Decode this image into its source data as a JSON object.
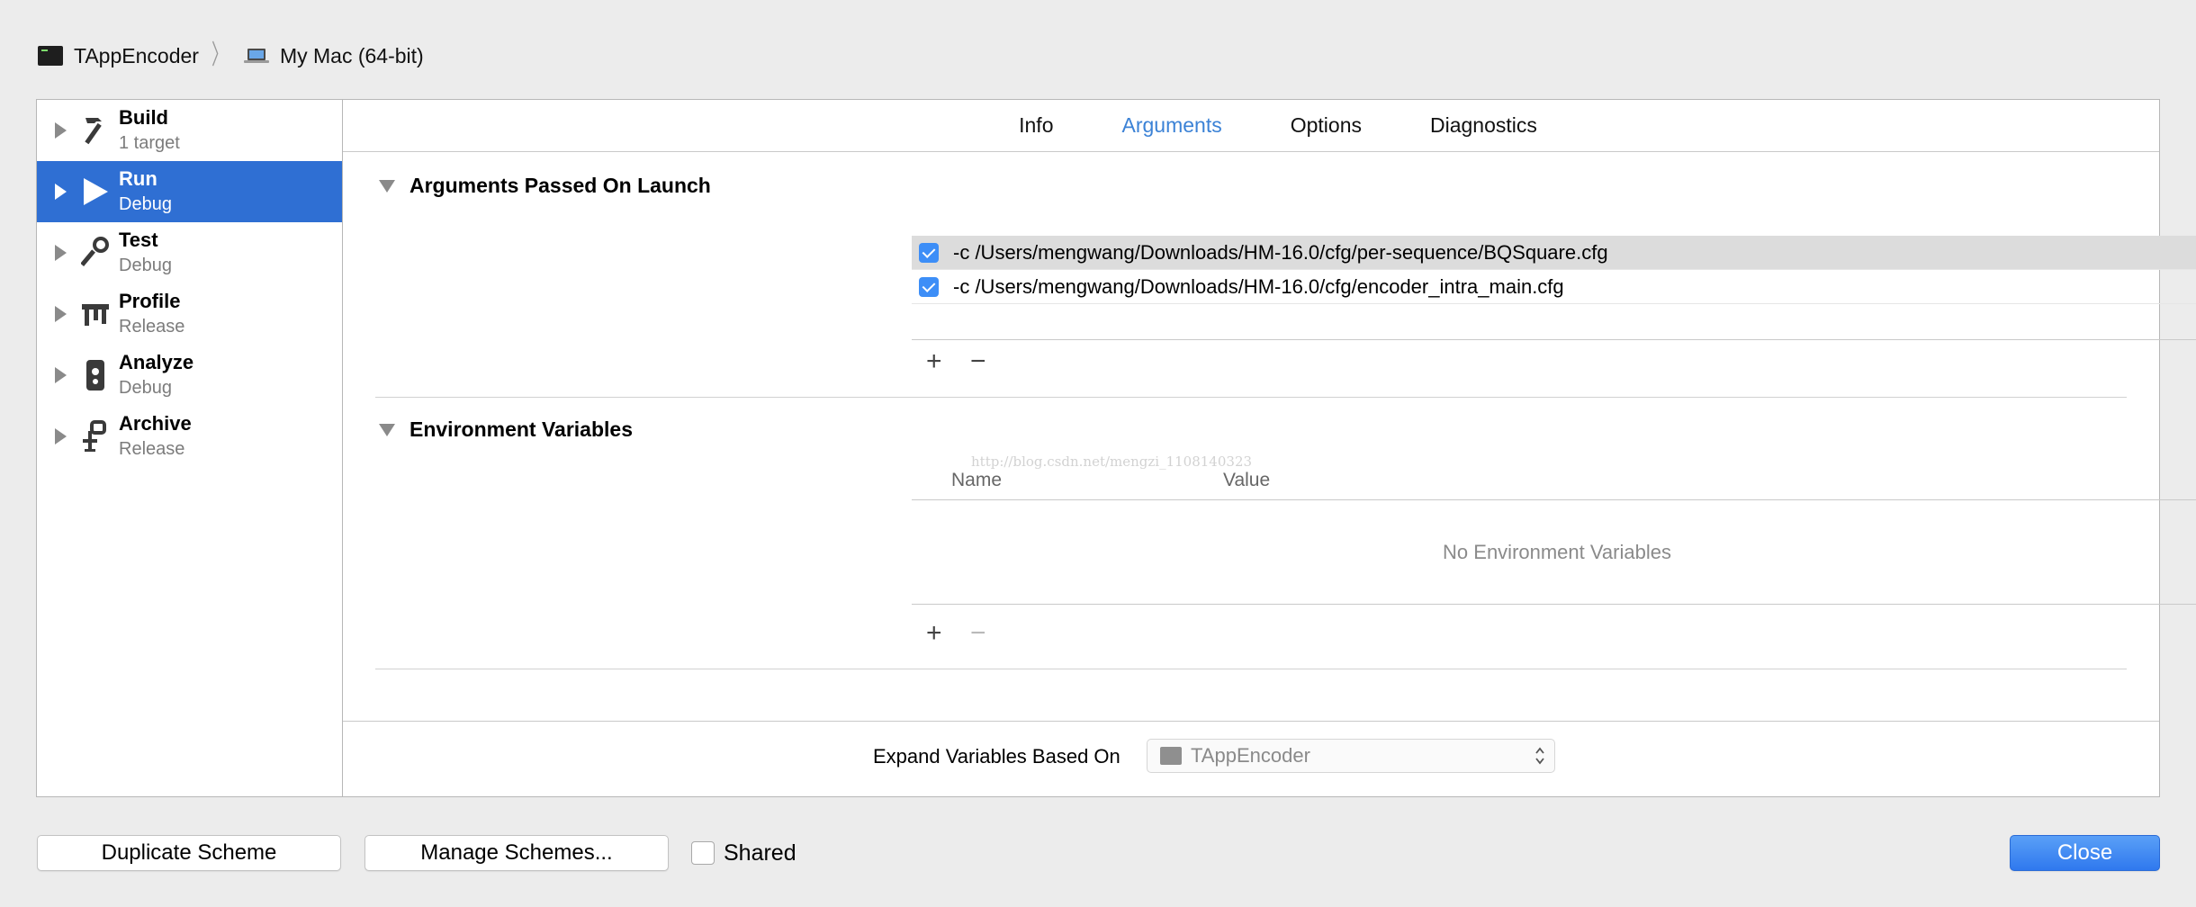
{
  "breadcrumb": {
    "target": "TAppEncoder",
    "destination": "My Mac (64-bit)"
  },
  "sidebar": {
    "items": [
      {
        "title": "Build",
        "subtitle": "1 target",
        "icon": "hammer-icon"
      },
      {
        "title": "Run",
        "subtitle": "Debug",
        "icon": "play-icon",
        "selected": true
      },
      {
        "title": "Test",
        "subtitle": "Debug",
        "icon": "wrench-icon"
      },
      {
        "title": "Profile",
        "subtitle": "Release",
        "icon": "instruments-icon"
      },
      {
        "title": "Analyze",
        "subtitle": "Debug",
        "icon": "analyze-icon"
      },
      {
        "title": "Archive",
        "subtitle": "Release",
        "icon": "archive-icon"
      }
    ]
  },
  "tabs": [
    {
      "label": "Info"
    },
    {
      "label": "Arguments",
      "active": true
    },
    {
      "label": "Options"
    },
    {
      "label": "Diagnostics"
    }
  ],
  "arguments_section": {
    "title": "Arguments Passed On Launch",
    "rows": [
      {
        "text": "-c /Users/mengwang/Downloads/HM-16.0/cfg/per-sequence/BQSquare.cfg",
        "checked": true
      },
      {
        "text": "-c /Users/mengwang/Downloads/HM-16.0/cfg/encoder_intra_main.cfg",
        "checked": true
      }
    ],
    "add_label": "+",
    "remove_label": "−"
  },
  "environment_section": {
    "title": "Environment Variables",
    "col_name": "Name",
    "col_value": "Value",
    "empty_text": "No Environment Variables",
    "add_label": "+",
    "remove_label": "−"
  },
  "watermark": "http://blog.csdn.net/mengzi_1108140323",
  "expand": {
    "label": "Expand Variables Based On",
    "selected": "TAppEncoder"
  },
  "footer": {
    "duplicate": "Duplicate Scheme",
    "manage": "Manage Schemes...",
    "shared": "Shared",
    "close": "Close"
  },
  "colors": {
    "accent": "#2f6fd3",
    "tab_active": "#3b82d6",
    "checkbox": "#3d8ef7"
  }
}
